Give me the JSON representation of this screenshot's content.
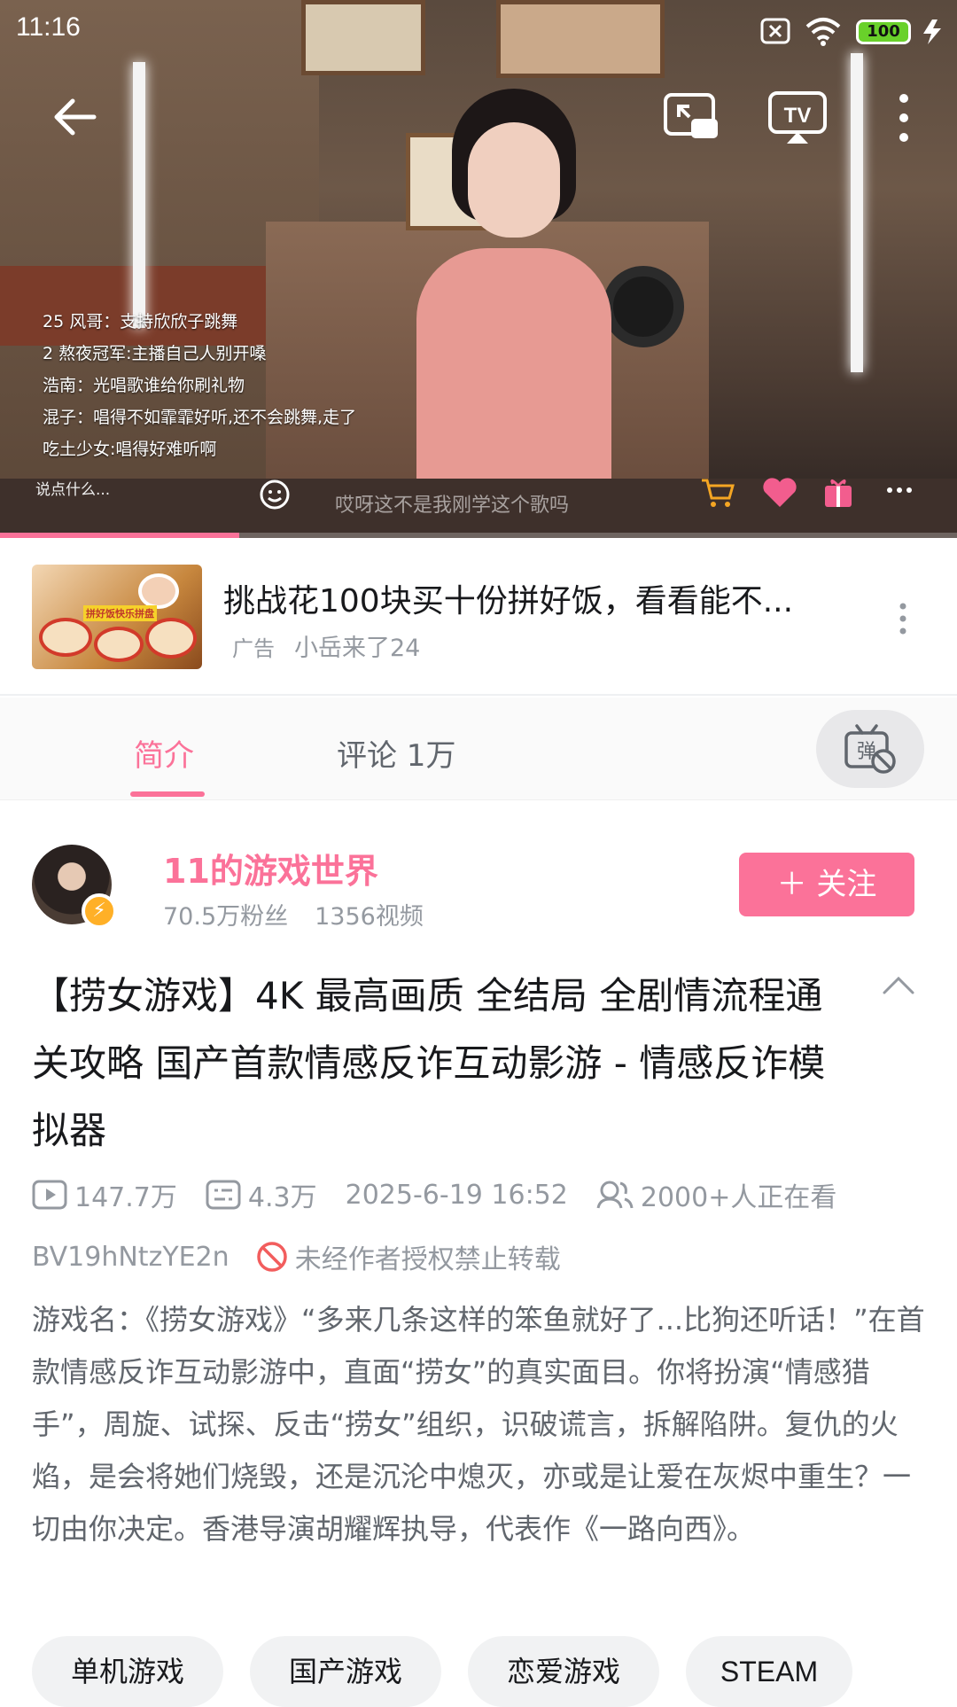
{
  "status_bar": {
    "time": "11:16",
    "battery": "100"
  },
  "player": {
    "danmaku": [
      {
        "level": "25",
        "text": "风哥：支持欣欣子跳舞"
      },
      {
        "level": "2",
        "text": "熬夜冠军:主播自己人别开嗓"
      },
      {
        "level": "",
        "text": "浩南：光唱歌谁给你刷礼物"
      },
      {
        "level": "",
        "text": "混子：唱得不如霏霏好听,还不会跳舞,走了"
      },
      {
        "level": "",
        "text": "吃土少女:唱得好难听啊"
      }
    ],
    "chat_placeholder": "说点什么...",
    "subtitle": "哎呀这不是我刚学这个歌吗",
    "progress": 0.25
  },
  "ad": {
    "title": "挑战花100块买十份拼好饭，看看能不...",
    "label": "广告",
    "author": "小岳来了24",
    "thumb_tag": "拼好饭快乐拼盘"
  },
  "tabs": {
    "intro": "简介",
    "comments": "评论 1万",
    "danmu_icon": "弹"
  },
  "uploader": {
    "name": "11的游戏世界",
    "fans": "70.5万粉丝",
    "videos": "1356视频",
    "follow_label": "＋ 关注"
  },
  "video": {
    "title": "【捞女游戏】4K 最高画质 全结局 全剧情流程通关攻略 国产首款情感反诈互动影游 - 情感反诈模拟器",
    "plays": "147.7万",
    "danmaku_count": "4.3万",
    "date": "2025-6-19 16:52",
    "watching": "2000+人正在看",
    "bvid": "BV19hNtzYE2n",
    "no_repost": "未经作者授权禁止转载",
    "description": "游戏名：《捞女游戏》“多来几条这样的笨鱼就好了...比狗还听话！”在首款情感反诈互动影游中，直面“捞女”的真实面目。你将扮演“情感猎手”，周旋、试探、反击“捞女”组织，识破谎言，拆解陷阱。复仇的火焰，是会将她们烧毁，还是沉沦中熄灭，亦或是让爱在灰烬中重生？一切由你决定。香港导演胡耀辉执导，代表作《一路向西》。",
    "tags": [
      "单机游戏",
      "国产游戏",
      "恋爱游戏",
      "STEAM"
    ]
  },
  "colors": {
    "accent": "#fb7299",
    "muted": "#9499a0"
  }
}
